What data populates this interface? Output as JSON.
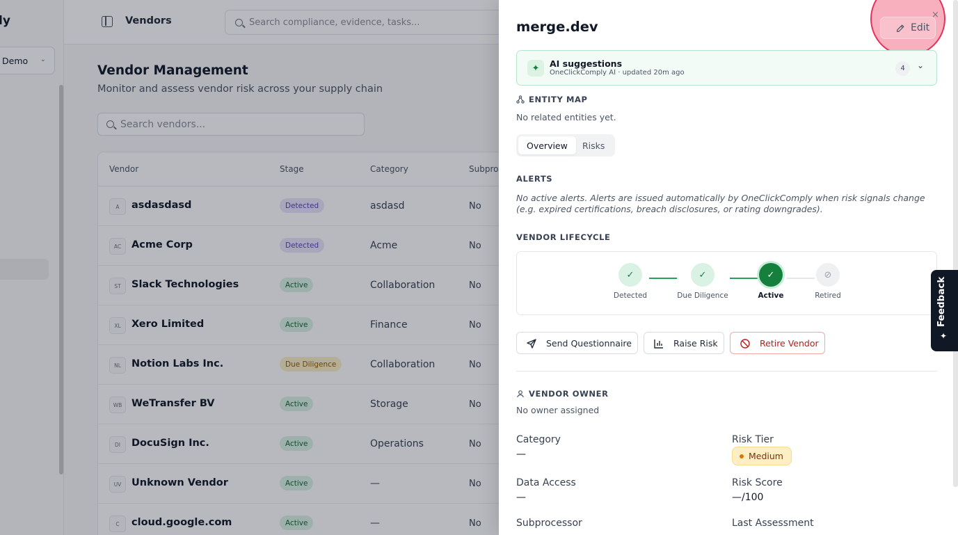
{
  "sidebar": {
    "brand": "ly",
    "org": "Demo"
  },
  "topbar": {
    "crumb": "Vendors",
    "search_placeholder": "Search compliance, evidence, tasks..."
  },
  "page": {
    "title": "Vendor Management",
    "subtitle": "Monitor and assess vendor risk across your supply chain",
    "search_placeholder": "Search vendors..."
  },
  "table": {
    "headers": [
      "Vendor",
      "Stage",
      "Category",
      "Subproc"
    ],
    "rows": [
      {
        "initials": "A",
        "name": "asdasdasd",
        "stage": "Detected",
        "category": "asdasd",
        "sub": "No"
      },
      {
        "initials": "AC",
        "name": "Acme Corp",
        "stage": "Detected",
        "category": "Acme",
        "sub": "No"
      },
      {
        "initials": "ST",
        "name": "Slack Technologies",
        "stage": "Active",
        "category": "Collaboration",
        "sub": "No"
      },
      {
        "initials": "XL",
        "name": "Xero Limited",
        "stage": "Active",
        "category": "Finance",
        "sub": "No"
      },
      {
        "initials": "NL",
        "name": "Notion Labs Inc.",
        "stage": "Due Diligence",
        "category": "Collaboration",
        "sub": "No"
      },
      {
        "initials": "WB",
        "name": "WeTransfer BV",
        "stage": "Active",
        "category": "Storage",
        "sub": "No"
      },
      {
        "initials": "DI",
        "name": "DocuSign Inc.",
        "stage": "Active",
        "category": "Operations",
        "sub": "No"
      },
      {
        "initials": "UV",
        "name": "Unknown Vendor",
        "stage": "Active",
        "category": "—",
        "sub": "No"
      },
      {
        "initials": "C",
        "name": "cloud.google.com",
        "stage": "Active",
        "category": "—",
        "sub": "No"
      }
    ]
  },
  "drawer": {
    "title": "merge.dev",
    "edit_label": "Edit",
    "close_glyph": "×",
    "ai": {
      "title": "AI suggestions",
      "meta": "OneClickComply AI · updated 20m ago",
      "count": "4"
    },
    "entity_map": {
      "label": "ENTITY MAP",
      "empty": "No related entities yet."
    },
    "tabs": [
      "Overview",
      "Risks"
    ],
    "alerts": {
      "label": "ALERTS",
      "text": "No active alerts. Alerts are issued automatically by OneClickComply when risk signals change (e.g. expired certifications, breach disclosures, or rating downgrades)."
    },
    "lifecycle": {
      "label": "VENDOR LIFECYCLE",
      "steps": [
        "Detected",
        "Due Diligence",
        "Active",
        "Retired"
      ],
      "current_index": 2
    },
    "actions": {
      "send": "Send Questionnaire",
      "raise": "Raise Risk",
      "retire": "Retire Vendor"
    },
    "owner": {
      "label": "VENDOR OWNER",
      "value": "No owner assigned"
    },
    "fields": {
      "category_label": "Category",
      "category_value": "—",
      "risk_tier_label": "Risk Tier",
      "risk_tier_value": "Medium",
      "data_access_label": "Data Access",
      "data_access_value": "—",
      "risk_score_label": "Risk Score",
      "risk_score_value": "—/100",
      "subprocessor_label": "Subprocessor",
      "last_assessment_label": "Last Assessment"
    }
  },
  "feedback": {
    "label": "Feedback"
  },
  "colors": {
    "accent": "#15803d",
    "danger": "#b91c1c",
    "highlight": "#e11d48"
  }
}
